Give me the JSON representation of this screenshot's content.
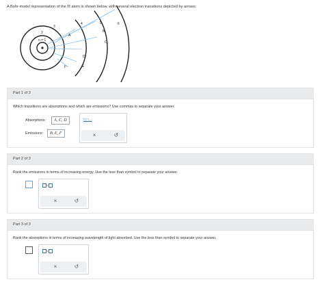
{
  "intro": {
    "before": "A Bohr-model representation of the ",
    "element": "H",
    "after": " atom is shown below, with several electron transitions depicted by arrows:"
  },
  "diagram": {
    "shell_labels": [
      "n = 1",
      "2",
      "3",
      "4",
      "5",
      "6"
    ],
    "transition_labels": [
      "A",
      "B",
      "C",
      "D",
      "E",
      "F"
    ],
    "line_color": "#8fc3ea",
    "circle_color": "#222222"
  },
  "part1": {
    "header": "Part 1 of 3",
    "question": "Which transitions are absorptions and which are emissions? Use commas to separate your answer.",
    "absorptions_label": "Absorptions:",
    "absorptions_value": "A, C, D",
    "emissions_label": "Emissions:",
    "emissions_value": "B, E, F",
    "template_link": "□,□,...",
    "clear_icon": "×",
    "undo_icon": "↺"
  },
  "part2": {
    "header": "Part 2 of 3",
    "question": "Rank the emissions in terms of increasing energy. Use the less than symbol to separate your answer.",
    "less_symbol": "<",
    "clear_icon": "×",
    "undo_icon": "↺"
  },
  "part3": {
    "header": "Part 3 of 3",
    "question": "Rank the absorptions in terms of increasing wavelength of light absorbed. Use the less than symbol to separate your answer.",
    "less_symbol": "<",
    "clear_icon": "×",
    "undo_icon": "↺"
  }
}
